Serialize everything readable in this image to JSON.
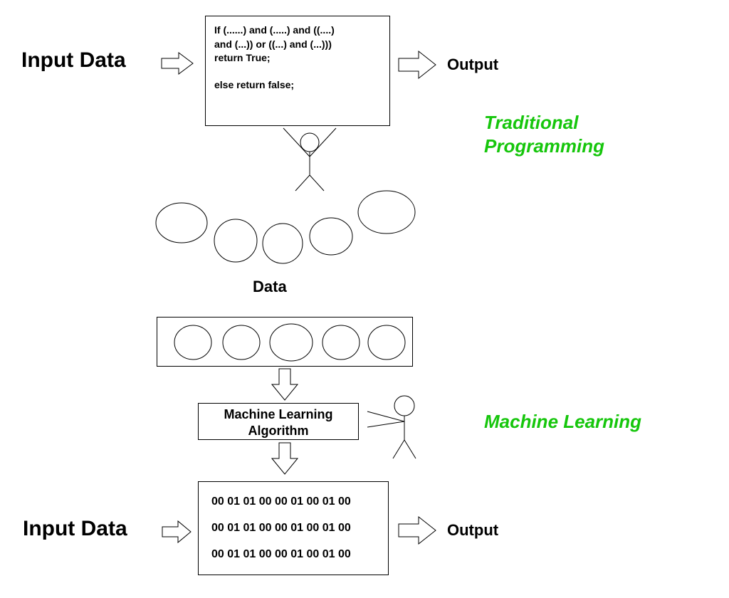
{
  "top": {
    "input_label": "Input Data",
    "output_label": "Output",
    "code_line1": "If (......) and (.....) and ((....)",
    "code_line2": "and (...)) or ((...) and (...)))",
    "code_line3": "return True;",
    "code_line4": "else return false;",
    "section_label": "Traditional\nProgramming"
  },
  "mid": {
    "data_label": "Data"
  },
  "bottom": {
    "algo_label_line1": "Machine Learning",
    "algo_label_line2": "Algorithm",
    "section_label": "Machine Learning",
    "input_label": "Input Data",
    "output_label": "Output",
    "binary_row1": "00 01 01 00 00 01 00 01 00",
    "binary_row2": "00 01 01 00 00 01 00 01 00",
    "binary_row3": "00 01 01 00 00 01 00 01 00"
  }
}
